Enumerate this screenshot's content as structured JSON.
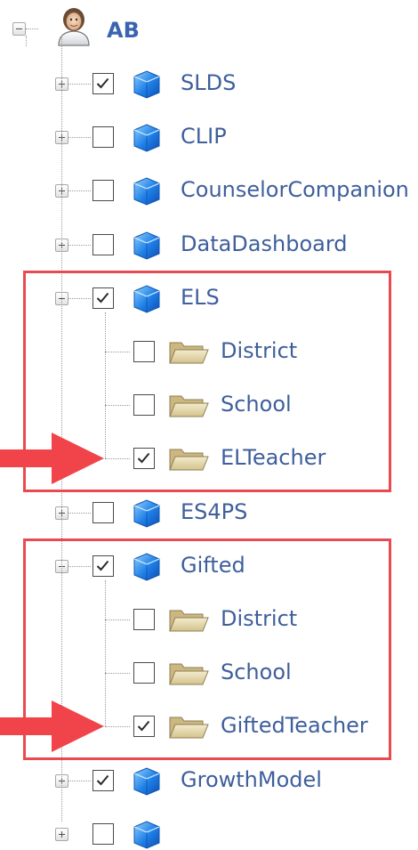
{
  "root": {
    "label": "AB",
    "icon": "user-avatar-icon",
    "expanded": true
  },
  "nodes": [
    {
      "label": "SLDS",
      "checked": true,
      "expanded": false,
      "icon": "blue-cube-icon"
    },
    {
      "label": "CLIP",
      "checked": false,
      "expanded": false,
      "icon": "blue-cube-icon"
    },
    {
      "label": "CounselorCompanion",
      "checked": false,
      "expanded": false,
      "icon": "blue-cube-icon"
    },
    {
      "label": "DataDashboard",
      "checked": false,
      "expanded": false,
      "icon": "blue-cube-icon"
    },
    {
      "label": "ELS",
      "checked": true,
      "expanded": true,
      "icon": "blue-cube-icon",
      "children": [
        {
          "label": "District",
          "checked": false,
          "icon": "folder-icon"
        },
        {
          "label": "School",
          "checked": false,
          "icon": "folder-icon"
        },
        {
          "label": "ELTeacher",
          "checked": true,
          "icon": "folder-icon"
        }
      ]
    },
    {
      "label": "ES4PS",
      "checked": false,
      "expanded": false,
      "icon": "blue-cube-icon"
    },
    {
      "label": "Gifted",
      "checked": true,
      "expanded": true,
      "icon": "blue-cube-icon",
      "children": [
        {
          "label": "District",
          "checked": false,
          "icon": "folder-icon"
        },
        {
          "label": "School",
          "checked": false,
          "icon": "folder-icon"
        },
        {
          "label": "GiftedTeacher",
          "checked": true,
          "icon": "folder-icon"
        }
      ]
    },
    {
      "label": "GrowthModel",
      "checked": true,
      "expanded": false,
      "icon": "blue-cube-icon"
    }
  ],
  "colors": {
    "label_text": "#3e5f9c",
    "highlight_box": "#e84a50",
    "arrow": "#f0444a"
  }
}
